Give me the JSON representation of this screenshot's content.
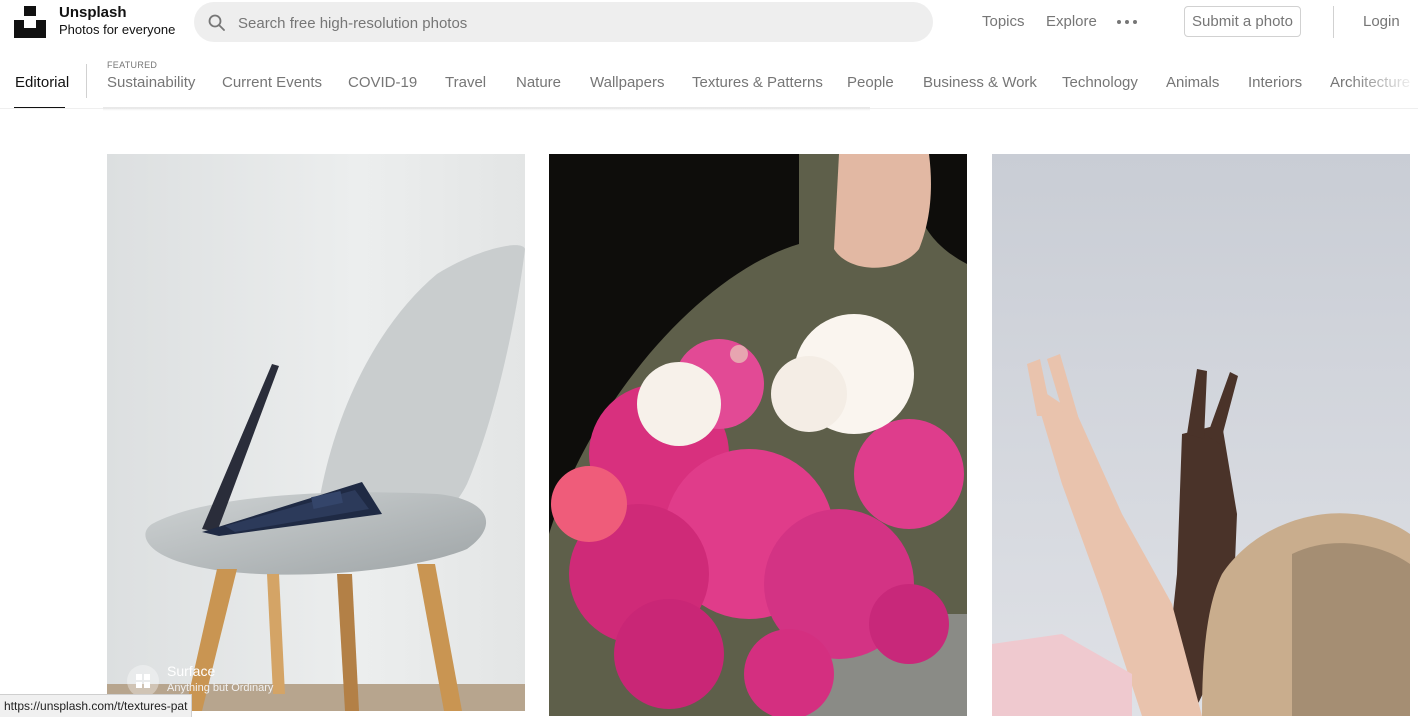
{
  "header": {
    "brand_name": "Unsplash",
    "brand_tagline": "Photos for everyone",
    "search_placeholder": "Search free high-resolution photos",
    "search_value": "",
    "nav": {
      "topics": "Topics",
      "explore": "Explore"
    },
    "submit_label": "Submit a photo",
    "login_label": "Login",
    "icons": {
      "logo": "unsplash-logo",
      "search": "search-icon",
      "more": "more-dots-icon"
    }
  },
  "topic_nav": {
    "editorial": "Editorial",
    "featured_label": "FEATURED",
    "items": [
      "Sustainability",
      "Current Events",
      "COVID-19",
      "Travel",
      "Nature",
      "Wallpapers",
      "Textures & Patterns",
      "People",
      "Business & Work",
      "Technology",
      "Animals",
      "Interiors",
      "Architecture"
    ]
  },
  "photos": [
    {
      "subject": "laptop on grey chair",
      "sponsor": {
        "name": "Surface",
        "tagline": "Anything but Ordinary"
      }
    },
    {
      "subject": "woman holding pink peonies"
    },
    {
      "subject": "hands making peace signs"
    }
  ],
  "status_bar": {
    "url": "https://unsplash.com/t/textures-pat"
  },
  "colors": {
    "text_primary": "#111111",
    "text_muted": "#767676",
    "search_bg": "#eeeeee",
    "border": "#d1d1d1"
  }
}
